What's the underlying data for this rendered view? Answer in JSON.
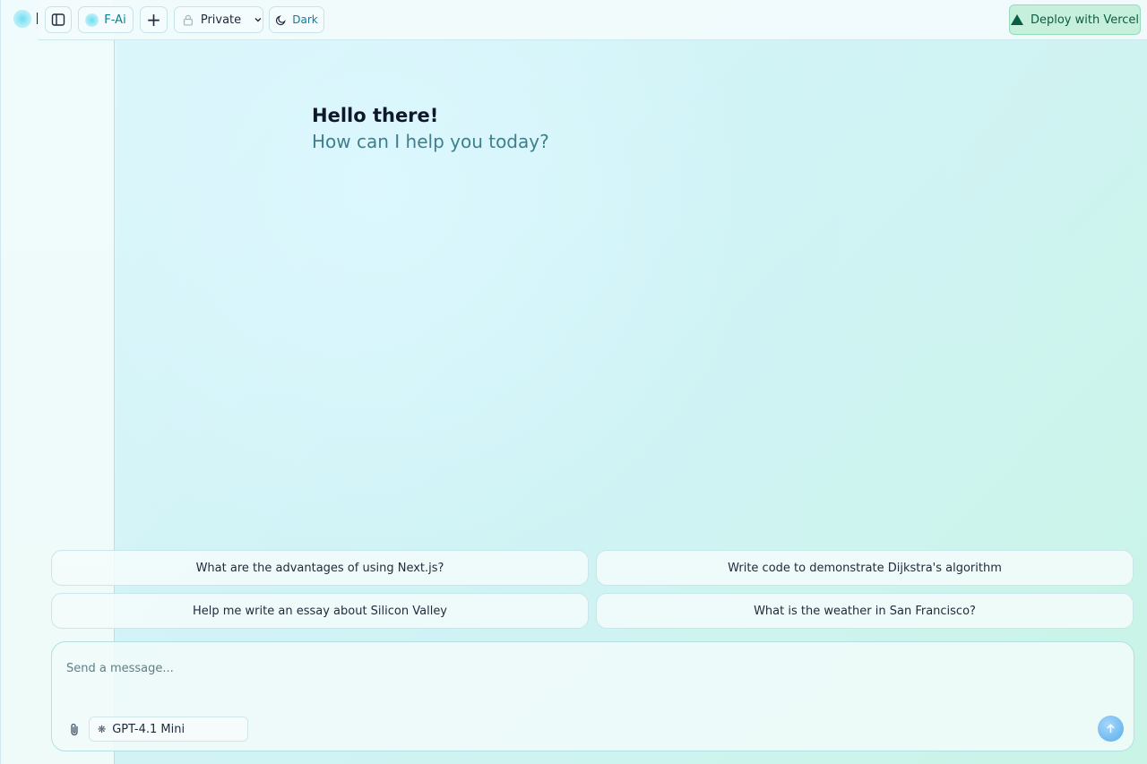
{
  "header": {
    "brand_label": "F-Ai",
    "plus_label": "+",
    "visibility_label": "Private",
    "theme_label": "Dark",
    "deploy_label": "Deploy with Vercel"
  },
  "greeting": {
    "title": "Hello there!",
    "subtitle": "How can I help you today?"
  },
  "suggestions": [
    "What are the advantages of using Next.js?",
    "Write code to demonstrate Dijkstra's algorithm",
    "Help me write an essay about Silicon Valley",
    "What is the weather in San Francisco?"
  ],
  "composer": {
    "placeholder": "Send a message...",
    "value": "",
    "model_label": "GPT-4.1 Mini"
  },
  "colors": {
    "accent": "#0f7c95",
    "deploy_bg": "#c6f0dc",
    "deploy_text": "#0b5c45",
    "send_button": "#6eb9f0"
  },
  "icons": {
    "sidebar_toggle": "sidebar-toggle-icon",
    "brand": "brand-orb-icon",
    "new_chat": "plus-icon",
    "lock": "lock-icon",
    "visibility_dropdown": "chevron-down-icon",
    "theme": "moon-icon",
    "deploy": "vercel-triangle-icon",
    "attach": "paperclip-icon",
    "model": "openai-icon",
    "send": "arrow-up-icon"
  }
}
